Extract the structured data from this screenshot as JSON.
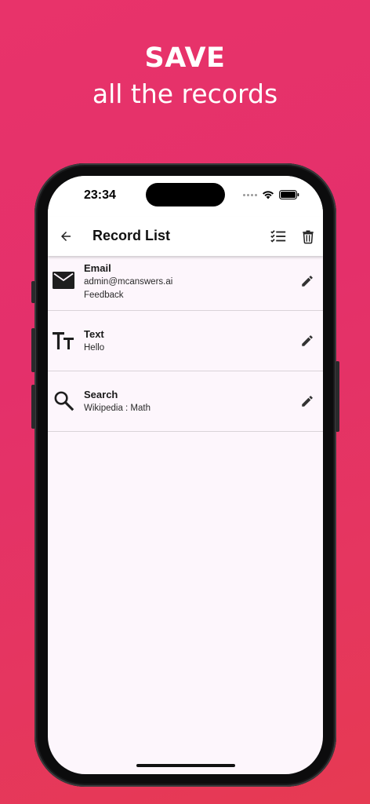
{
  "hero": {
    "title": "SAVE",
    "subtitle": "all the records"
  },
  "status_bar": {
    "time": "23:34",
    "icons": [
      "signal-dots-icon",
      "wifi-icon",
      "battery-icon"
    ]
  },
  "app_bar": {
    "title": "Record List",
    "back_icon": "arrow-left-icon",
    "actions": [
      {
        "name": "select-all",
        "icon": "checklist-icon"
      },
      {
        "name": "delete",
        "icon": "trash-icon"
      }
    ]
  },
  "records": [
    {
      "type_icon": "envelope-icon",
      "title": "Email",
      "lines": [
        "admin@mcanswers.ai",
        "Feedback"
      ],
      "action_icon": "pencil-icon"
    },
    {
      "type_icon": "text-fields-icon",
      "title": "Text",
      "lines": [
        "Hello"
      ],
      "action_icon": "pencil-icon"
    },
    {
      "type_icon": "search-icon",
      "title": "Search",
      "lines": [
        "Wikipedia : Math"
      ],
      "action_icon": "pencil-icon"
    }
  ],
  "colors": {
    "background_gradient_start": "#e8336a",
    "background_gradient_end": "#e63a52",
    "screen_background": "#fdf6fc",
    "icon_color": "#222222"
  }
}
